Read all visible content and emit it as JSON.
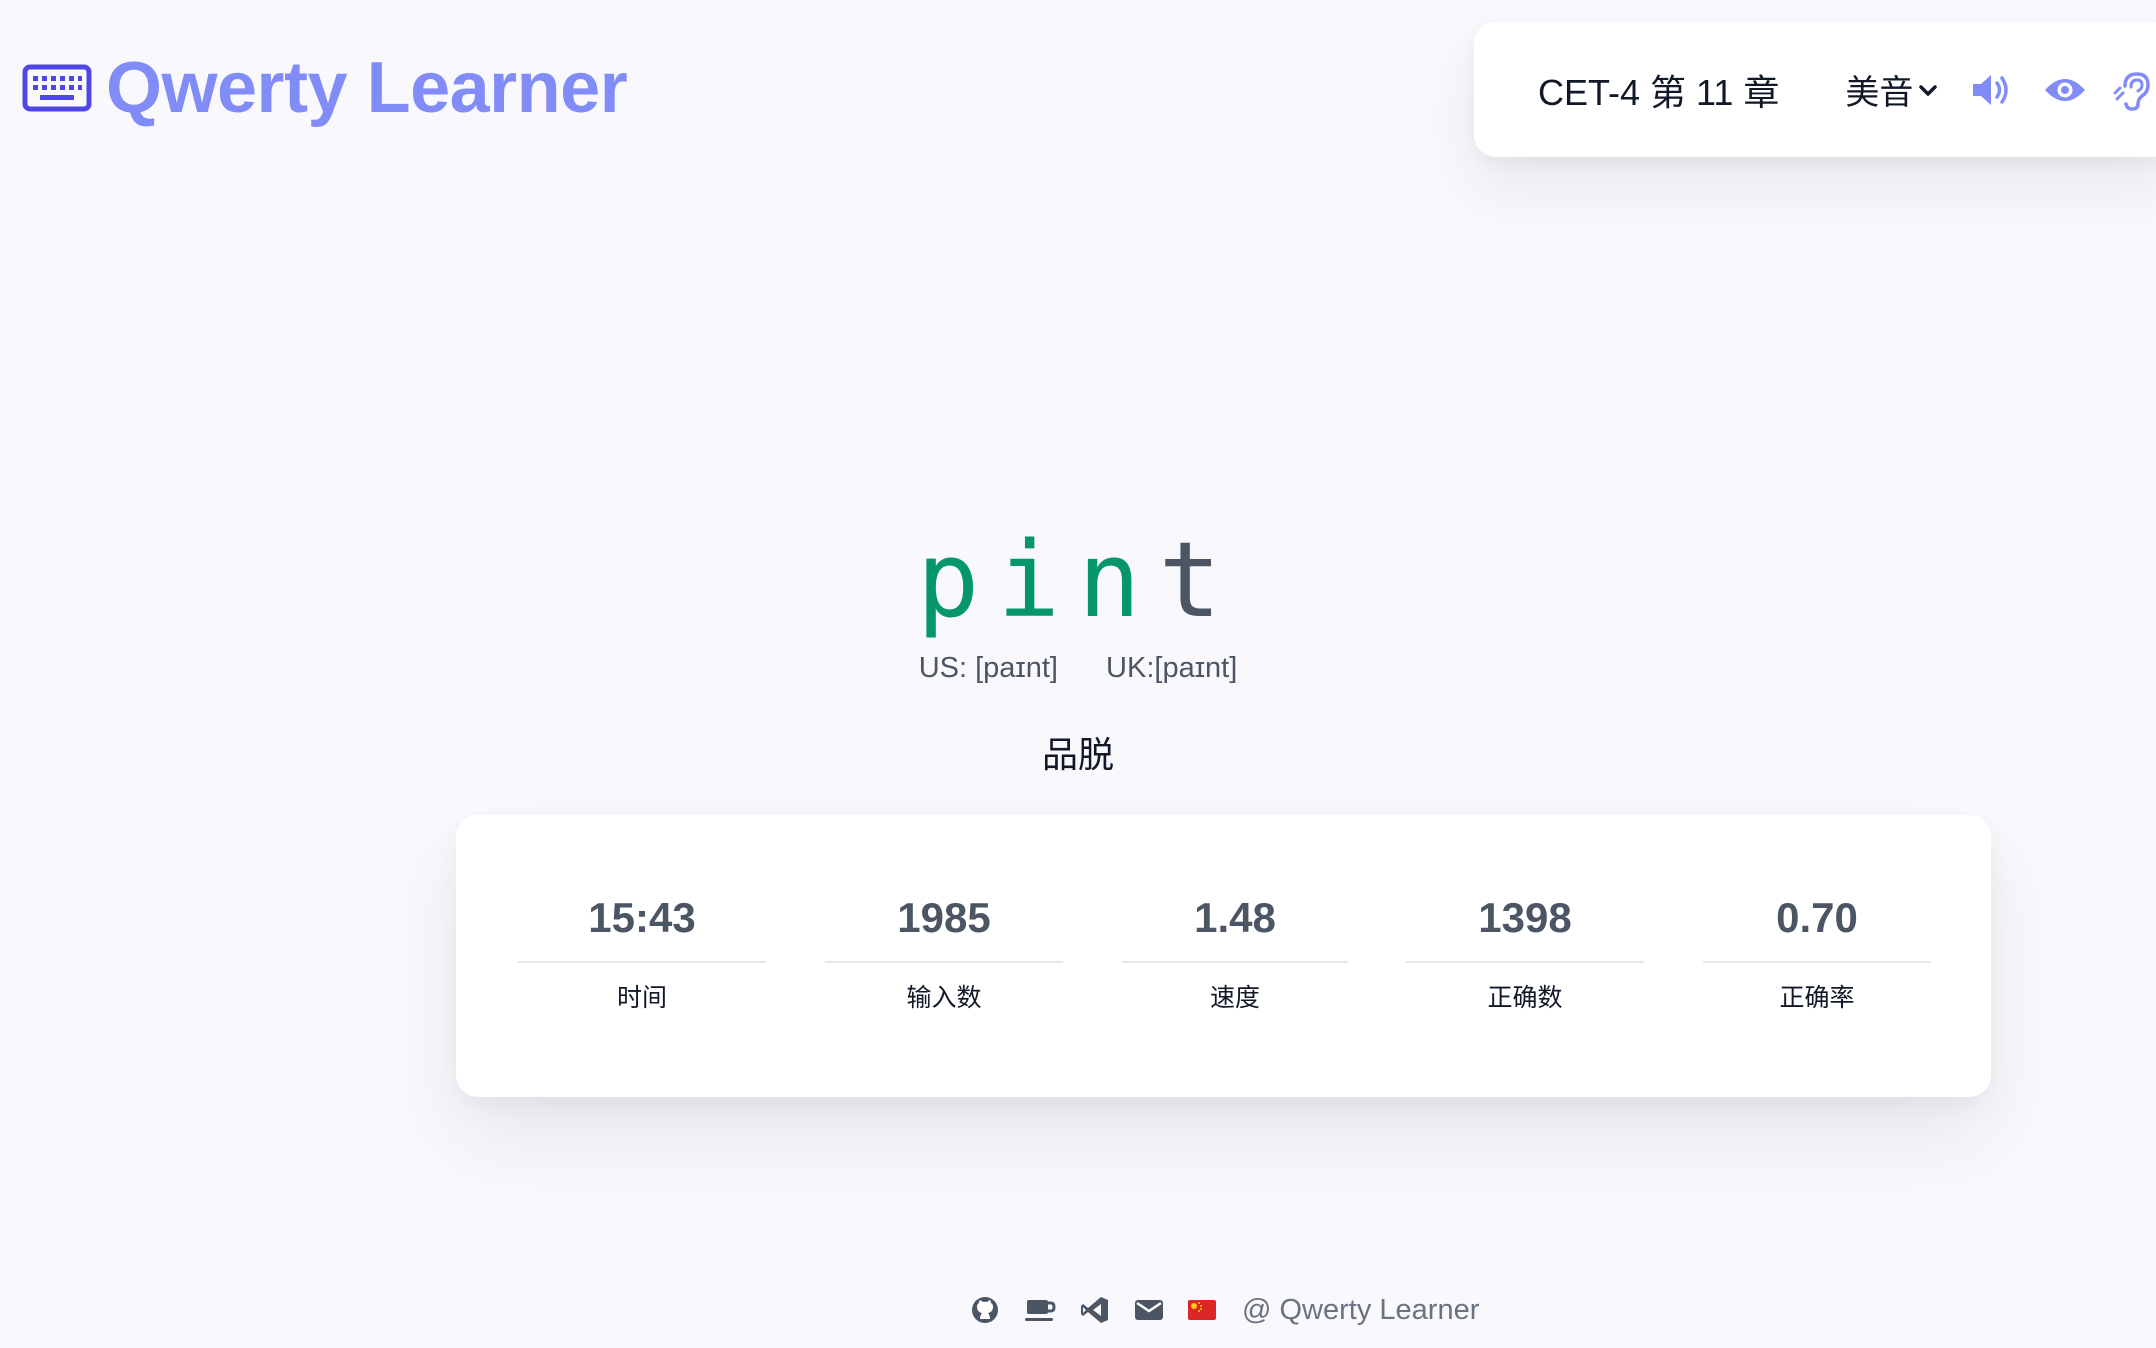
{
  "app": {
    "title": "Qwerty Learner",
    "logo_icon": "keyboard-icon",
    "brand_color": "#818cf8"
  },
  "toolbar": {
    "dictionary_chapter": "CET-4 第 11 章",
    "accent": "美音",
    "icons": [
      "chevron-down-icon",
      "speaker-icon",
      "eye-icon",
      "ear-icon"
    ]
  },
  "word": {
    "typed": "pin",
    "untyped": "t",
    "typed_color": "#059669",
    "untyped_color": "#4b5563"
  },
  "phonetics": {
    "us": "US: [paɪnt]",
    "uk": "UK:[paɪnt]"
  },
  "translation": "品脱",
  "stats": [
    {
      "value": "15:43",
      "label": "时间"
    },
    {
      "value": "1985",
      "label": "输入数"
    },
    {
      "value": "1.48",
      "label": "速度"
    },
    {
      "value": "1398",
      "label": "正确数"
    },
    {
      "value": "0.70",
      "label": "正确率"
    }
  ],
  "footer": {
    "icons": [
      "github-icon",
      "coffee-icon",
      "vscode-icon",
      "mail-icon",
      "china-flag-icon"
    ],
    "text": "@ Qwerty Learner"
  }
}
